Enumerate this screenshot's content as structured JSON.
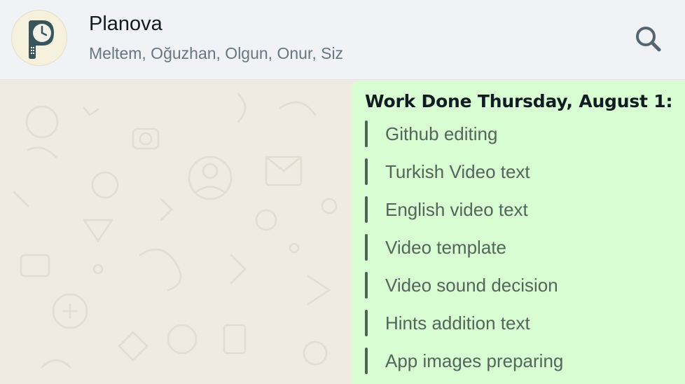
{
  "header": {
    "title": "Planova",
    "members": "Meltem, Oğuzhan, Olgun, Onur, Siz",
    "avatar_icon": "planova-logo-icon",
    "search_icon": "search-icon"
  },
  "message": {
    "title": "Work Done Thursday, August 1:",
    "items": [
      "Github editing",
      "Turkish Video text",
      "English video text",
      "Video template",
      "Video sound decision",
      "Hints addition text",
      "App images preparing"
    ]
  },
  "colors": {
    "header_bg": "#f0f2f5",
    "chat_bg": "#efeae2",
    "bubble_bg": "#d9fdd3",
    "quote_bar": "#52605a",
    "secondary_text": "#667781"
  }
}
